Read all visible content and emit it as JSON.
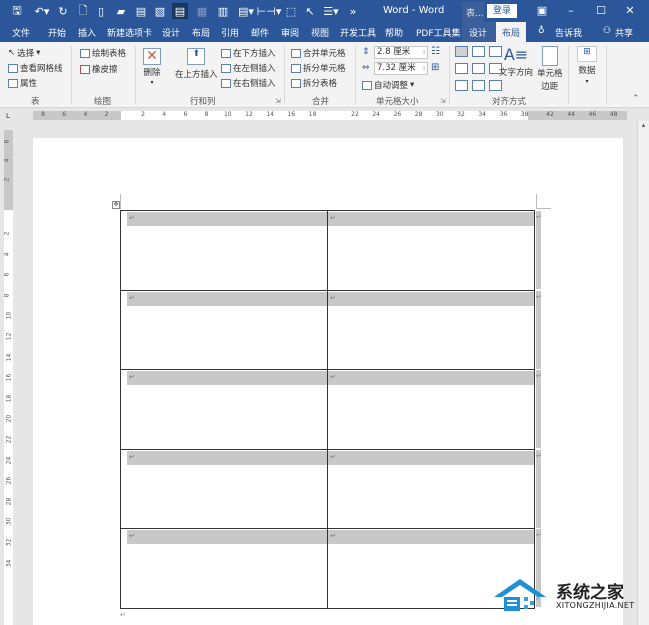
{
  "window": {
    "title": "Word  -  Word",
    "context_tab_title": "表...",
    "login_label": "登录",
    "controls": [
      "ribbon-display-icon",
      "minimize-icon",
      "maximize-icon",
      "close-icon"
    ]
  },
  "quick_access": [
    "save-icon",
    "undo-icon",
    "redo-icon",
    "print-preview-icon",
    "new-doc-icon",
    "open-icon",
    "paste-icon",
    "screenshot-icon",
    "reading-view-icon",
    "disabled-icon",
    "columns-icon",
    "paste-special-icon",
    "distribute-icon",
    "select-object-icon",
    "pointer-icon",
    "list-icon",
    "more-icon"
  ],
  "tabs": [
    {
      "label": "文件"
    },
    {
      "label": "开始"
    },
    {
      "label": "插入"
    },
    {
      "label": "新建选项卡"
    },
    {
      "label": "设计"
    },
    {
      "label": "布局"
    },
    {
      "label": "引用"
    },
    {
      "label": "邮件"
    },
    {
      "label": "审阅"
    },
    {
      "label": "视图"
    },
    {
      "label": "开发工具"
    },
    {
      "label": "帮助"
    },
    {
      "label": "PDF工具集"
    },
    {
      "label": "设计"
    },
    {
      "label": "布局"
    }
  ],
  "tell_me": "告诉我",
  "share": "共享",
  "ribbon": {
    "table_group": {
      "label": "表",
      "select": "选择",
      "gridlines": "查看网格线",
      "properties": "属性"
    },
    "draw_group": {
      "label": "绘图",
      "draw_table": "绘制表格",
      "eraser": "橡皮擦"
    },
    "rows_cols_group": {
      "label": "行和列",
      "delete": "删除",
      "insert_above": "在上方插入",
      "insert_below": "在下方插入",
      "insert_left": "在左侧插入",
      "insert_right": "在右侧插入"
    },
    "merge_group": {
      "label": "合并",
      "merge_cells": "合并单元格",
      "split_cells": "拆分单元格",
      "split_table": "拆分表格"
    },
    "cell_size_group": {
      "label": "单元格大小",
      "height": "2.8 厘米",
      "width": "7.32 厘米",
      "autofit": "自动调整"
    },
    "alignment_group": {
      "label": "对齐方式",
      "text_direction": "文字方向",
      "cell_margins_1": "单元格",
      "cell_margins_2": "边距"
    },
    "data_group": {
      "label": "数据"
    }
  },
  "ruler": {
    "corner": "L",
    "horizontal_left": [
      "8",
      "6",
      "4",
      "2"
    ],
    "horizontal_main": [
      "2",
      "4",
      "6",
      "8",
      "10",
      "12",
      "14",
      "16",
      "18",
      "22",
      "24",
      "26",
      "28",
      "30",
      "32",
      "34",
      "36",
      "38"
    ],
    "horizontal_right": [
      "42",
      "44",
      "46",
      "48"
    ],
    "vertical_top": [
      "6",
      "4",
      "2"
    ],
    "vertical_main": [
      "2",
      "4",
      "6",
      "8",
      "10",
      "12",
      "14",
      "16",
      "18",
      "20",
      "22",
      "24",
      "26",
      "28",
      "30",
      "32",
      "34"
    ]
  },
  "document": {
    "rows": 5,
    "cols": 2,
    "paragraph_mark": "↵"
  },
  "watermark": {
    "title": "系统之家",
    "subtitle": "XITONGZHIJIA.NET"
  }
}
